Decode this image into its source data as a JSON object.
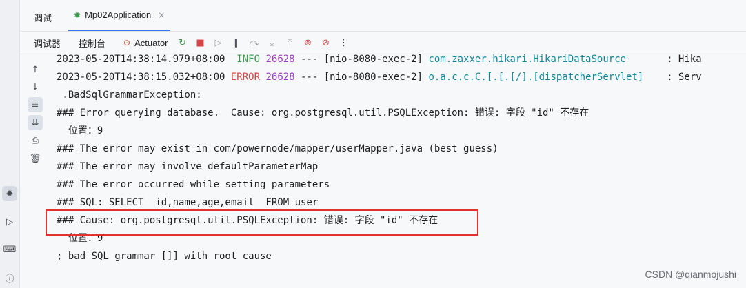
{
  "tabs": {
    "debug_label": "调试",
    "app_label": "Mp02Application",
    "close_icon": "×"
  },
  "toolbar": {
    "debugger_label": "调试器",
    "console_label": "控制台",
    "actuator_label": "Actuator"
  },
  "console": {
    "line1": {
      "timestamp": "2023-05-20T14:38:14.979+08:00 ",
      "level": " INFO",
      "pid": " 26628",
      "sep": " --- [nio-8080-exec-2] ",
      "logger": "com.zaxxer.hikari.HikariDataSource      ",
      "msg": " : Hika"
    },
    "line2": {
      "timestamp": "2023-05-20T14:38:15.032+08:00 ",
      "level": "ERROR",
      "pid": " 26628",
      "sep": " --- [nio-8080-exec-2] ",
      "logger": "o.a.c.c.C.[.[.[/].[dispatcherServlet]   ",
      "msg": " : Serv"
    },
    "lines": [
      " .BadSqlGrammarException:",
      "### Error querying database.  Cause: org.postgresql.util.PSQLException: 错误: 字段 \"id\" 不存在",
      "  位置：9",
      "### The error may exist in com/powernode/mapper/userMapper.java (best guess)",
      "### The error may involve defaultParameterMap",
      "### The error occurred while setting parameters",
      "### SQL: SELECT  id,name,age,email  FROM user",
      "### Cause: org.postgresql.util.PSQLException: 错误: 字段 \"id\" 不存在",
      "  位置：9",
      "; bad SQL grammar []] with root cause"
    ]
  },
  "watermark": "CSDN @qianmojushi"
}
